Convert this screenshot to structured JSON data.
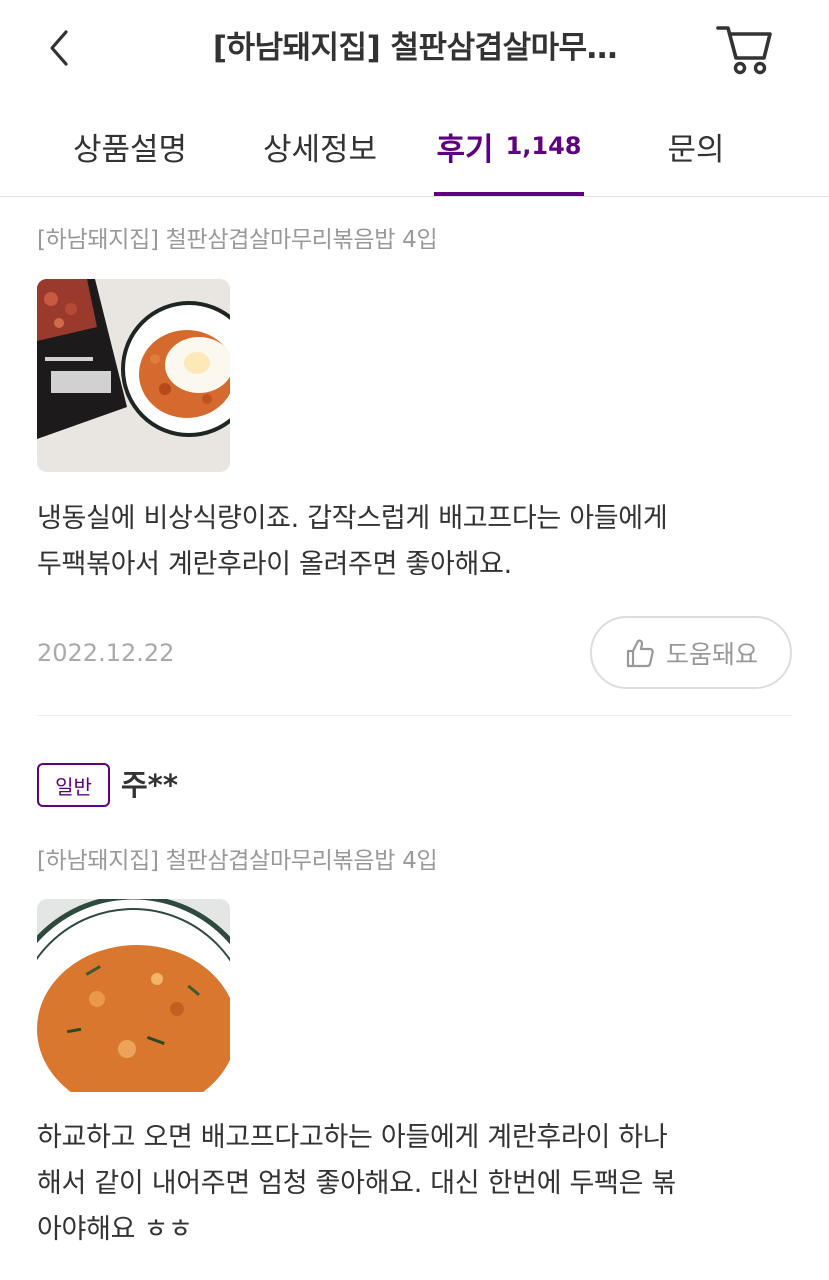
{
  "header": {
    "title": "[하남돼지집] 철판삼겹살마무…",
    "back_icon": "chevron-left-icon",
    "cart_icon": "cart-icon"
  },
  "tabs": [
    {
      "label": "상품설명"
    },
    {
      "label": "상세정보"
    },
    {
      "label": "후기",
      "count": "1,148"
    },
    {
      "label": "문의"
    }
  ],
  "colors": {
    "accent": "#5f0080",
    "muted": "#999999",
    "text": "#333333"
  },
  "reviews": [
    {
      "product": "[하남돼지집] 철판삼겹살마무리볶음밥 4입",
      "text_lines": [
        "냉동실에 비상식량이죠. 갑작스럽게 배고프다는 아들에게",
        "두팩볶아서 계란후라이 올려주면 좋아해요."
      ],
      "date": "2022.12.22",
      "helpful_label": "도움돼요"
    },
    {
      "grade": "일반",
      "reviewer": "주**",
      "product": "[하남돼지집] 철판삼겹살마무리볶음밥 4입",
      "text_lines": [
        "하교하고 오면 배고프다고하는 아들에게 계란후라이 하나",
        "해서 같이 내어주면 엄청 좋아해요. 대신 한번에 두팩은 볶",
        "아야해요 ㅎㅎ"
      ]
    }
  ]
}
